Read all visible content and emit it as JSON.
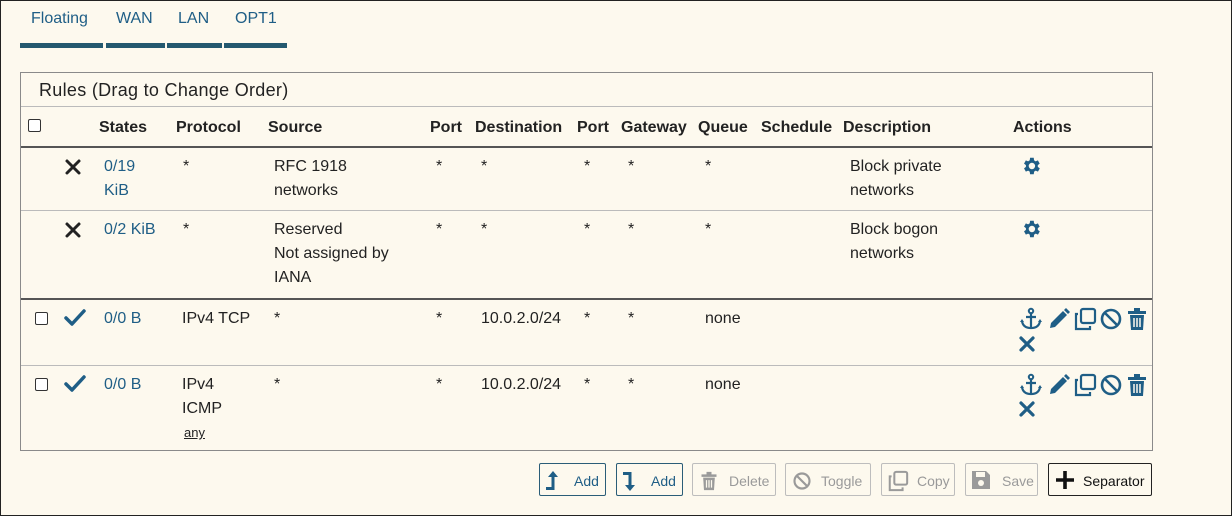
{
  "tabs": [
    "Floating",
    "WAN",
    "LAN",
    "OPT1"
  ],
  "panel": {
    "title": "Rules (Drag to Change Order)",
    "columns": {
      "states": "States",
      "protocol": "Protocol",
      "source": "Source",
      "port": "Port",
      "destination": "Destination",
      "port2": "Port",
      "gateway": "Gateway",
      "queue": "Queue",
      "schedule": "Schedule",
      "description": "Description",
      "actions": "Actions"
    }
  },
  "rules": [
    {
      "status_icon": "block-x-icon",
      "states_line1": "0/19",
      "states_line2": "KiB",
      "protocol": "*",
      "source_line1": "RFC 1918",
      "source_line2": "networks",
      "port": "*",
      "destination": "*",
      "port2": "*",
      "gateway": "*",
      "queue": "*",
      "description_line1": "Block private",
      "description_line2": "networks",
      "actions": [
        "gear-icon"
      ]
    },
    {
      "status_icon": "block-x-icon",
      "states_line1": "0/2 KiB",
      "protocol": "*",
      "source_line1": "Reserved",
      "source_line2": "Not assigned by",
      "source_line3": "IANA",
      "port": "*",
      "destination": "*",
      "port2": "*",
      "gateway": "*",
      "queue": "*",
      "description_line1": "Block bogon",
      "description_line2": "networks",
      "actions": [
        "gear-icon"
      ]
    },
    {
      "status_icon": "pass-check-icon",
      "states_line1": "0/0 B",
      "protocol_line1": "IPv4 TCP",
      "source_line1": "*",
      "port": "*",
      "destination": "10.0.2.0/24",
      "port2": "*",
      "gateway": "*",
      "queue": "none",
      "actions": [
        "anchor-icon",
        "pencil-icon",
        "copy-icon",
        "disable-icon",
        "trash-icon",
        "delete-x-icon"
      ]
    },
    {
      "status_icon": "pass-check-icon",
      "states_line1": "0/0 B",
      "protocol_line1": "IPv4",
      "protocol_line2": "ICMP",
      "protocol_sub": "any",
      "source_line1": "*",
      "port": "*",
      "destination": "10.0.2.0/24",
      "port2": "*",
      "gateway": "*",
      "queue": "none",
      "actions": [
        "anchor-icon",
        "pencil-icon",
        "copy-icon",
        "disable-icon",
        "trash-icon",
        "delete-x-icon"
      ]
    }
  ],
  "buttons": {
    "add_top": "Add",
    "add_bottom": "Add",
    "delete": "Delete",
    "toggle": "Toggle",
    "copy": "Copy",
    "save": "Save",
    "separator": "Separator"
  },
  "colors": {
    "link": "#1f5e86",
    "accent": "#24596f",
    "background": "#fdf9ee"
  }
}
